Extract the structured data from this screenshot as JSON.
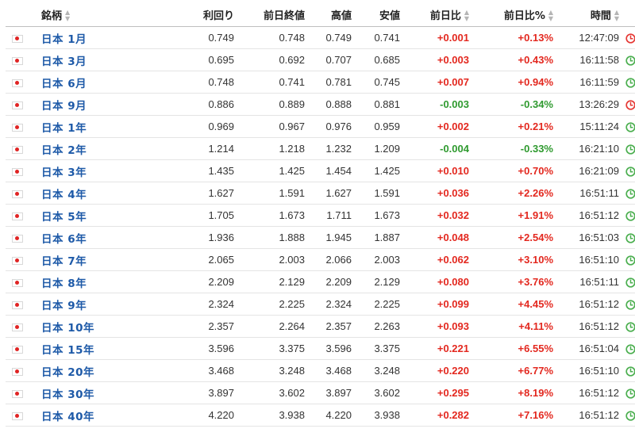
{
  "header": {
    "name": "銘柄",
    "yield": "利回り",
    "prev_close": "前日終値",
    "high": "高値",
    "low": "安値",
    "change": "前日比",
    "change_pct": "前日比%",
    "time": "時間"
  },
  "colors": {
    "up": "#e3281f",
    "down": "#2f9a2f",
    "link": "#1e5aa8",
    "clock_open": "#4caf50",
    "clock_closed": "#e53935"
  },
  "rows": [
    {
      "name": "日本 1月",
      "yield": "0.749",
      "prev": "0.748",
      "high": "0.749",
      "low": "0.741",
      "chg": "+0.001",
      "pct": "+0.13%",
      "time": "12:47:09",
      "dir": "up",
      "clock": "red"
    },
    {
      "name": "日本 3月",
      "yield": "0.695",
      "prev": "0.692",
      "high": "0.707",
      "low": "0.685",
      "chg": "+0.003",
      "pct": "+0.43%",
      "time": "16:11:58",
      "dir": "up",
      "clock": "green"
    },
    {
      "name": "日本 6月",
      "yield": "0.748",
      "prev": "0.741",
      "high": "0.781",
      "low": "0.745",
      "chg": "+0.007",
      "pct": "+0.94%",
      "time": "16:11:59",
      "dir": "up",
      "clock": "green"
    },
    {
      "name": "日本 9月",
      "yield": "0.886",
      "prev": "0.889",
      "high": "0.888",
      "low": "0.881",
      "chg": "-0.003",
      "pct": "-0.34%",
      "time": "13:26:29",
      "dir": "down",
      "clock": "red"
    },
    {
      "name": "日本 1年",
      "yield": "0.969",
      "prev": "0.967",
      "high": "0.976",
      "low": "0.959",
      "chg": "+0.002",
      "pct": "+0.21%",
      "time": "15:11:24",
      "dir": "up",
      "clock": "green"
    },
    {
      "name": "日本 2年",
      "yield": "1.214",
      "prev": "1.218",
      "high": "1.232",
      "low": "1.209",
      "chg": "-0.004",
      "pct": "-0.33%",
      "time": "16:21:10",
      "dir": "down",
      "clock": "green"
    },
    {
      "name": "日本 3年",
      "yield": "1.435",
      "prev": "1.425",
      "high": "1.454",
      "low": "1.425",
      "chg": "+0.010",
      "pct": "+0.70%",
      "time": "16:21:09",
      "dir": "up",
      "clock": "green"
    },
    {
      "name": "日本 4年",
      "yield": "1.627",
      "prev": "1.591",
      "high": "1.627",
      "low": "1.591",
      "chg": "+0.036",
      "pct": "+2.26%",
      "time": "16:51:11",
      "dir": "up",
      "clock": "green"
    },
    {
      "name": "日本 5年",
      "yield": "1.705",
      "prev": "1.673",
      "high": "1.711",
      "low": "1.673",
      "chg": "+0.032",
      "pct": "+1.91%",
      "time": "16:51:12",
      "dir": "up",
      "clock": "green"
    },
    {
      "name": "日本 6年",
      "yield": "1.936",
      "prev": "1.888",
      "high": "1.945",
      "low": "1.887",
      "chg": "+0.048",
      "pct": "+2.54%",
      "time": "16:51:03",
      "dir": "up",
      "clock": "green"
    },
    {
      "name": "日本 7年",
      "yield": "2.065",
      "prev": "2.003",
      "high": "2.066",
      "low": "2.003",
      "chg": "+0.062",
      "pct": "+3.10%",
      "time": "16:51:10",
      "dir": "up",
      "clock": "green"
    },
    {
      "name": "日本 8年",
      "yield": "2.209",
      "prev": "2.129",
      "high": "2.209",
      "low": "2.129",
      "chg": "+0.080",
      "pct": "+3.76%",
      "time": "16:51:11",
      "dir": "up",
      "clock": "green"
    },
    {
      "name": "日本 9年",
      "yield": "2.324",
      "prev": "2.225",
      "high": "2.324",
      "low": "2.225",
      "chg": "+0.099",
      "pct": "+4.45%",
      "time": "16:51:12",
      "dir": "up",
      "clock": "green"
    },
    {
      "name": "日本 10年",
      "yield": "2.357",
      "prev": "2.264",
      "high": "2.357",
      "low": "2.263",
      "chg": "+0.093",
      "pct": "+4.11%",
      "time": "16:51:12",
      "dir": "up",
      "clock": "green"
    },
    {
      "name": "日本 15年",
      "yield": "3.596",
      "prev": "3.375",
      "high": "3.596",
      "low": "3.375",
      "chg": "+0.221",
      "pct": "+6.55%",
      "time": "16:51:04",
      "dir": "up",
      "clock": "green"
    },
    {
      "name": "日本 20年",
      "yield": "3.468",
      "prev": "3.248",
      "high": "3.468",
      "low": "3.248",
      "chg": "+0.220",
      "pct": "+6.77%",
      "time": "16:51:10",
      "dir": "up",
      "clock": "green"
    },
    {
      "name": "日本 30年",
      "yield": "3.897",
      "prev": "3.602",
      "high": "3.897",
      "low": "3.602",
      "chg": "+0.295",
      "pct": "+8.19%",
      "time": "16:51:12",
      "dir": "up",
      "clock": "green"
    },
    {
      "name": "日本 40年",
      "yield": "4.220",
      "prev": "3.938",
      "high": "4.220",
      "low": "3.938",
      "chg": "+0.282",
      "pct": "+7.16%",
      "time": "16:51:12",
      "dir": "up",
      "clock": "green"
    }
  ]
}
